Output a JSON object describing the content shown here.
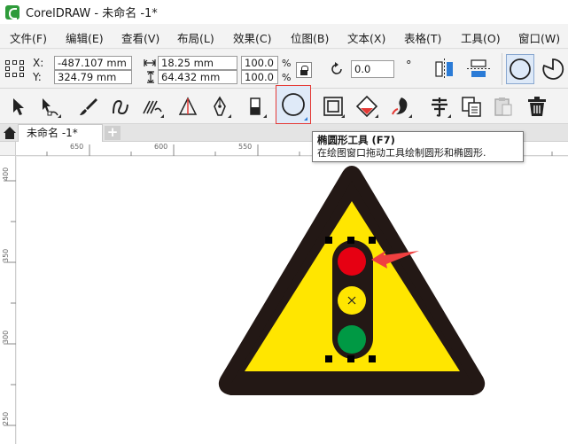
{
  "window": {
    "title": "CorelDRAW - 未命名 -1*"
  },
  "menu": [
    "文件(F)",
    "编辑(E)",
    "查看(V)",
    "布局(L)",
    "效果(C)",
    "位图(B)",
    "文本(X)",
    "表格(T)",
    "工具(O)",
    "窗口(W)"
  ],
  "property_bar": {
    "x_label": "X:",
    "x_value": "-487.107 mm",
    "y_label": "Y:",
    "y_value": "324.79 mm",
    "width_value": "18.25 mm",
    "height_value": "64.432 mm",
    "scale_w": "100.0",
    "scale_h": "100.0",
    "percent": "%",
    "rotation_value": "0.0",
    "degree": "°"
  },
  "tabs": {
    "document": "未命名 -1*",
    "add": "+"
  },
  "ruler": {
    "horizontal": [
      "650",
      "600",
      "550"
    ],
    "vertical": [
      "400",
      "350",
      "300",
      "250"
    ]
  },
  "tooltip": {
    "title": "椭圆形工具 (F7)",
    "description": "在绘图窗口拖动工具绘制圆形和椭圆形."
  },
  "icons": {
    "tools": [
      "pick-tool-icon",
      "shape-tool-icon",
      "artistic-media-icon",
      "freehand-icon",
      "smart-fill-icon",
      "dimension-icon",
      "pen-icon",
      "eraser-icon",
      "ellipse-tool-icon",
      "rectangle-frame-icon",
      "interactive-fill-icon",
      "shadow-icon",
      "text-icon",
      "copy-properties-icon",
      "paste-icon",
      "delete-icon"
    ],
    "shape_modes": [
      "ellipse-mode-icon",
      "pie-mode-icon"
    ]
  },
  "colors": {
    "accent_highlight": "#e53935",
    "sign_border": "#231815",
    "sign_fill": "#ffe600",
    "light_red": "#e60012",
    "light_yellow": "#ffe600",
    "light_green": "#009944"
  }
}
